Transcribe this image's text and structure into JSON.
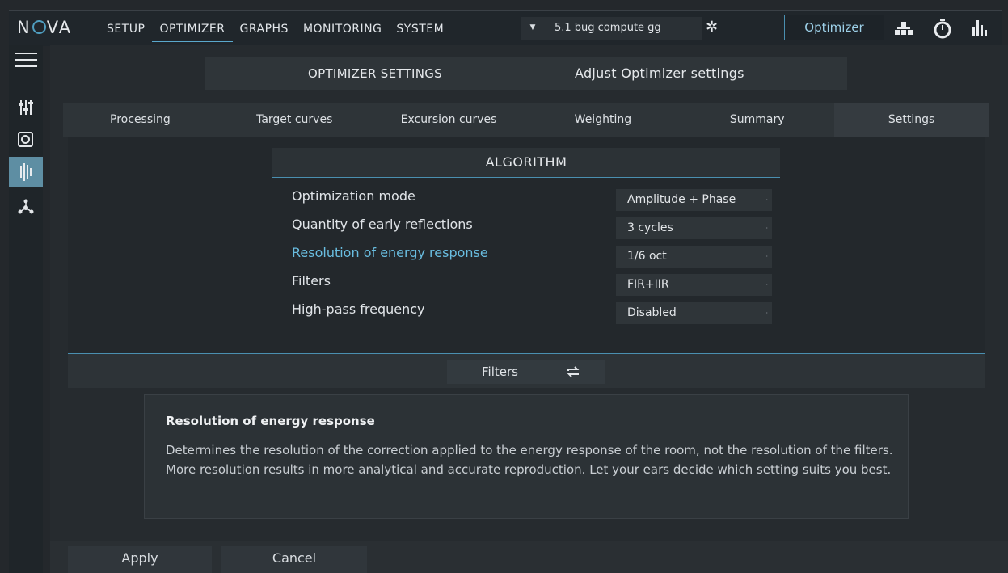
{
  "app": {
    "logo": "NOVA"
  },
  "nav": {
    "items": [
      "SETUP",
      "OPTIMIZER",
      "GRAPHS",
      "MONITORING",
      "SYSTEM"
    ],
    "active": "OPTIMIZER"
  },
  "preset": {
    "dropdown_icon": "caret-down-icon",
    "name": "5.1 bug compute gg",
    "settings_icon": "gear-icon"
  },
  "mode_button": {
    "label": "Optimizer"
  },
  "top_icons": [
    "network-icon",
    "stopwatch-icon",
    "bars-icon"
  ],
  "sidebar": {
    "icons": [
      "hamburger-menu-icon",
      "sliders-icon",
      "speaker-icon",
      "waveform-icon",
      "network-node-icon"
    ],
    "active": "waveform-icon"
  },
  "header": {
    "left": "OPTIMIZER SETTINGS",
    "right": "Adjust Optimizer settings"
  },
  "tabs": {
    "items": [
      "Processing",
      "Target curves",
      "Excursion curves",
      "Weighting",
      "Summary",
      "Settings"
    ],
    "active": "Settings"
  },
  "algorithm": {
    "title": "ALGORITHM",
    "settings": [
      {
        "label": "Optimization mode",
        "value": "Amplitude + Phase"
      },
      {
        "label": "Quantity of early reflections",
        "value": "3 cycles"
      },
      {
        "label": "Resolution of energy response",
        "value": "1/6 oct",
        "highlighted": true
      },
      {
        "label": "Filters",
        "value": "FIR+IIR"
      },
      {
        "label": "High-pass frequency",
        "value": "Disabled"
      }
    ]
  },
  "filters_bar": {
    "label": "Filters",
    "icon": "refresh-icon"
  },
  "description": {
    "title": "Resolution of energy response",
    "text": "Determines the resolution of the correction applied to the energy response of the room, not the resolution of the filters. More resolution results in more analytical and accurate reproduction. Let your ears decide which setting suits you best."
  },
  "footer": {
    "apply_label": "Apply",
    "cancel_label": "Cancel"
  },
  "colors": {
    "accent": "#5aa8cc",
    "highlight_text": "#69bde0",
    "background": "#24282c"
  }
}
